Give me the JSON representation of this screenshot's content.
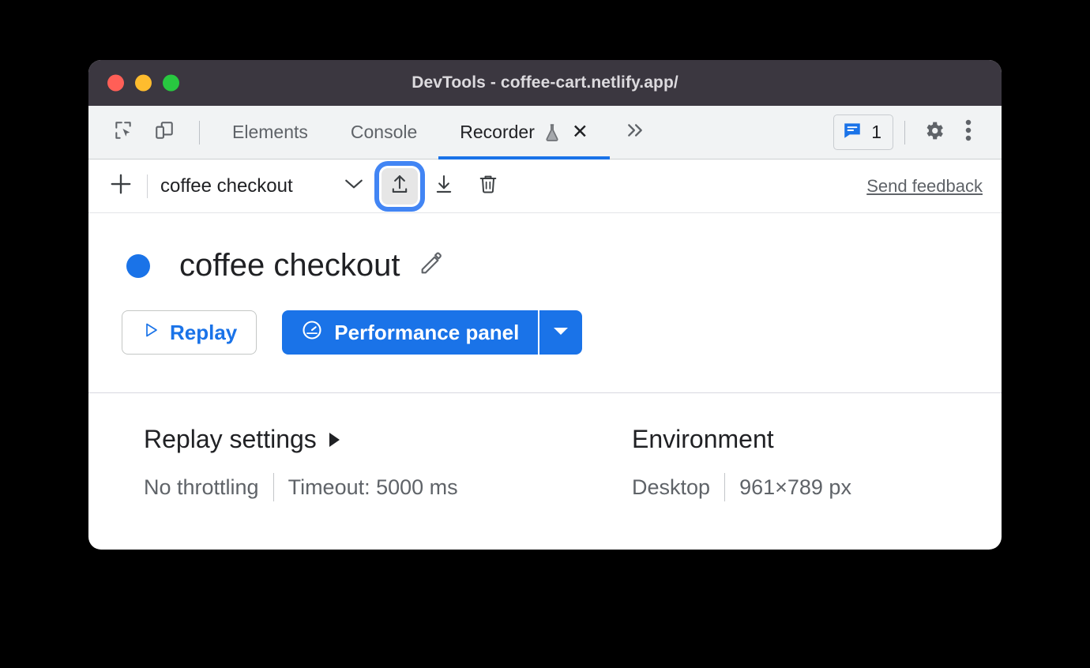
{
  "window": {
    "title": "DevTools - coffee-cart.netlify.app/",
    "traffic_lights": [
      "close",
      "minimize",
      "maximize"
    ],
    "colors": {
      "titlebar_bg": "#3b3740",
      "accent": "#1a73e8",
      "focus_ring": "#4285f4",
      "tabbar_bg": "#f1f3f4"
    }
  },
  "tabbar": {
    "left_icons": [
      {
        "name": "inspect-element-icon"
      },
      {
        "name": "device-toolbar-icon"
      }
    ],
    "tabs": [
      {
        "label": "Elements",
        "active": false
      },
      {
        "label": "Console",
        "active": false
      },
      {
        "label": "Recorder",
        "active": true,
        "experimental": true,
        "closable": true
      }
    ],
    "more_tabs_label": "»",
    "issues": {
      "icon": "issues-message-icon",
      "count": "1"
    },
    "settings_icon": "gear-icon",
    "more_options_icon": "three-dots-vertical-icon"
  },
  "recorder_toolbar": {
    "add_label": "+",
    "recording_name": "coffee checkout",
    "dropdown_icon": "chevron-down-icon",
    "import_label": "import-recording",
    "export_label": "export-recording",
    "delete_label": "delete-recording",
    "feedback_link": "Send feedback"
  },
  "recording": {
    "status_dot_color": "#1a73e8",
    "title": "coffee checkout",
    "edit_icon": "pencil-icon",
    "replay_button": "Replay",
    "replay_icon": "play-triangle-icon",
    "performance_button": "Performance panel",
    "performance_icon": "gauge-icon",
    "performance_dropdown_icon": "caret-down-icon"
  },
  "settings": {
    "replay": {
      "heading": "Replay settings",
      "expand_icon": "triangle-right-icon",
      "values": [
        "No throttling",
        "Timeout: 5000 ms"
      ]
    },
    "environment": {
      "heading": "Environment",
      "values": [
        "Desktop",
        "961×789 px"
      ]
    }
  }
}
